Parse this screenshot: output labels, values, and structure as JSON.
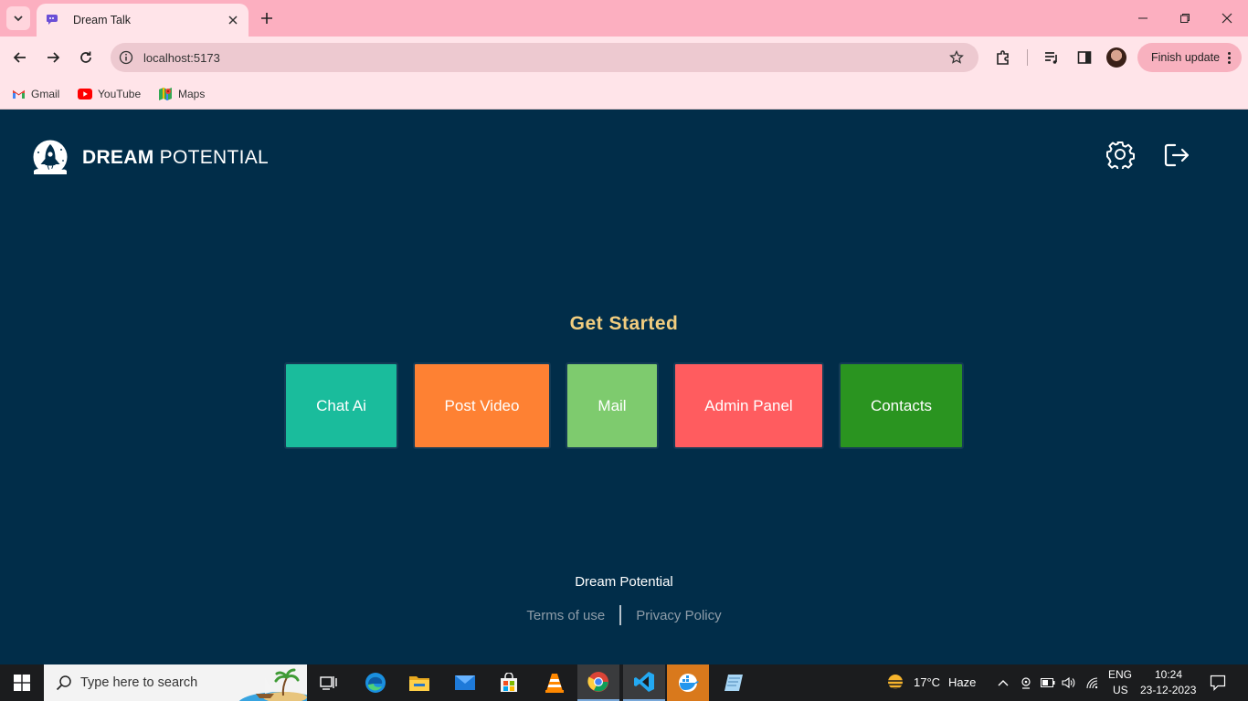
{
  "browser": {
    "tab_title": "Dream Talk",
    "url": "localhost:5173",
    "finish_update_label": "Finish update",
    "bookmarks": [
      {
        "label": "Gmail",
        "icon": "gmail-icon"
      },
      {
        "label": "YouTube",
        "icon": "youtube-icon"
      },
      {
        "label": "Maps",
        "icon": "maps-icon"
      }
    ]
  },
  "header": {
    "brand_bold": "DREAM",
    "brand_light": " POTENTIAL",
    "settings_icon": "gear-icon",
    "logout_icon": "logout-icon"
  },
  "main": {
    "heading": "Get Started",
    "cards": [
      {
        "label": "Chat Ai",
        "color": "#1abc9c"
      },
      {
        "label": "Post Video",
        "color": "#fe8133"
      },
      {
        "label": "Mail",
        "color": "#7ecb6e"
      },
      {
        "label": "Admin Panel",
        "color": "#ff5c5f"
      },
      {
        "label": "Contacts",
        "color": "#2a9420"
      }
    ]
  },
  "footer": {
    "title": "Dream Potential",
    "terms": "Terms of use",
    "privacy": "Privacy Policy"
  },
  "taskbar": {
    "search_placeholder": "Type here to search",
    "weather_temp": "17°C",
    "weather_condition": "Haze",
    "lang_top": "ENG",
    "lang_bottom": "US",
    "time": "10:24",
    "date": "23-12-2023"
  },
  "colors": {
    "page_bg": "#012d49",
    "heading": "#f2cd7f",
    "browser_frame": "#fcafc0"
  }
}
